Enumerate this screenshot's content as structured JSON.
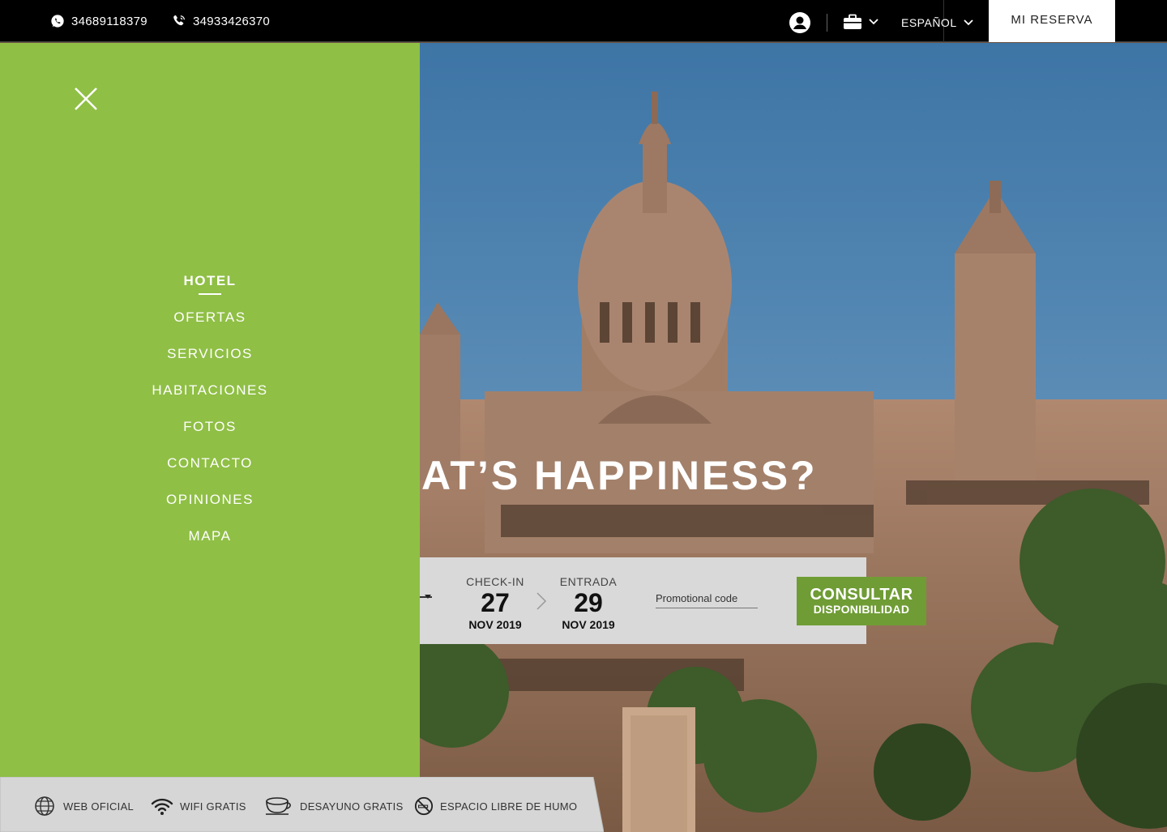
{
  "topbar": {
    "whatsapp_phone": "34689118379",
    "phone": "34933426370",
    "language": "ESPAÑOL",
    "mi_reserva": "MI RESERVA"
  },
  "menu": {
    "items": [
      {
        "label": "HOTEL",
        "active": true
      },
      {
        "label": "OFERTAS"
      },
      {
        "label": "SERVICIOS"
      },
      {
        "label": "HABITACIONES"
      },
      {
        "label": "FOTOS"
      },
      {
        "label": "CONTACTO"
      },
      {
        "label": "OPINIONES"
      },
      {
        "label": "MAPA"
      }
    ]
  },
  "hero": {
    "slogan_part1": "AT’S ",
    "slogan_highlight": "HAPPINESS?"
  },
  "booking": {
    "checkin_label": "CHECK-IN",
    "checkin_day": "27",
    "checkin_month_year": "NOV 2019",
    "checkout_label": "ENTRADA",
    "checkout_day": "29",
    "checkout_month_year": "NOV 2019",
    "promo_placeholder": "Promotional code",
    "consultar_line1": "CONSULTAR",
    "consultar_line2": "DISPONIBILIDAD"
  },
  "amenities": [
    {
      "label": "WEB OFICIAL",
      "icon": "globe-icon"
    },
    {
      "label": "WIFI GRATIS",
      "icon": "wifi-icon"
    },
    {
      "label": "DESAYUNO GRATIS",
      "icon": "coffee-cup-icon"
    },
    {
      "label": "ESPACIO LIBRE DE HUMO",
      "icon": "no-smoking-icon"
    }
  ],
  "colors": {
    "menu_green": "#8fbf45",
    "button_green": "#6f9c35",
    "highlight_green": "#84ba3f",
    "topbar": "#000000"
  }
}
